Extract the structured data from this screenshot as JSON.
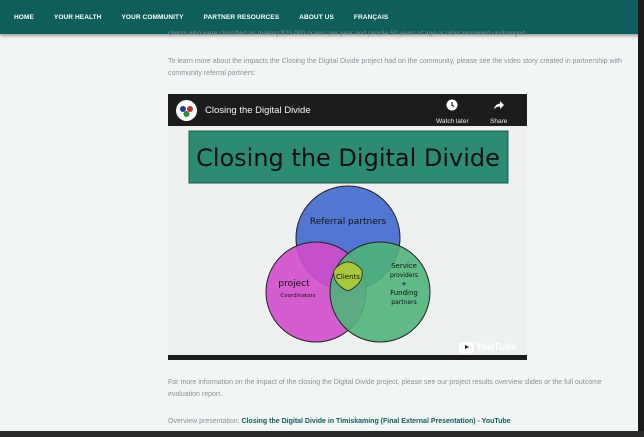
{
  "nav": {
    "items": [
      "HOME",
      "YOUR HEALTH",
      "YOUR COMMUNITY",
      "PARTNER RESOURCES",
      "ABOUT US",
      "FRANÇAIS"
    ]
  },
  "content": {
    "partial_line": "clients who were classified as making $25,000 or less per year and people 50 years of age or older remained unchanged.",
    "intro": "To learn more about the impacts the Closing the Digital Divide project had on the community, please see the video story created in partnership with community referral partners:",
    "more_info": "For more information on the impact of the closing the Digital Divide project, please see our project results overview slides or the full outcome evaluation report.",
    "overview_label": "Overview presentation:",
    "overview_link": "Closing the Digital Divide in Timiskaming (Final External Presentation) - YouTube"
  },
  "video": {
    "title": "Closing the Digital Divide",
    "watch_later": "Watch later",
    "share": "Share",
    "youtube_label": "YouTube",
    "board_title": "Closing the Digital Divide",
    "circle_top": "Referral partners",
    "circle_left_1": "project",
    "circle_left_2": "Coordinators",
    "circle_right_1": "Service",
    "circle_right_2": "providers",
    "circle_right_3": "+",
    "circle_right_4": "Funding",
    "circle_right_5": "partners",
    "center": "Clients"
  },
  "colors": {
    "nav_bg": "#0e5e5c",
    "link": "#0e5e5c",
    "board_green": "#2e8b73",
    "circle_blue": "#4a6fd0",
    "circle_magenta": "#d04ecb",
    "circle_green": "#4fb47a",
    "center_yellow": "#a8c83c"
  },
  "icons": [
    "clock-icon",
    "share-arrow-icon",
    "youtube-play-icon"
  ]
}
